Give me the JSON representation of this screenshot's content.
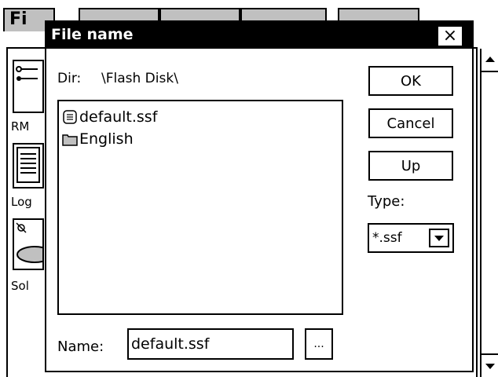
{
  "background": {
    "tab_file_label": "Fi",
    "items": [
      {
        "label": "RM",
        "icon": "connector-icon"
      },
      {
        "label": "Log",
        "icon": "log-document-icon"
      },
      {
        "label": "Sol",
        "icon": "satellite-dish-icon"
      }
    ]
  },
  "dialog": {
    "title": "File name",
    "close_label": "×",
    "dir_prefix": "Dir:",
    "dir_value": "\\Flash Disk\\",
    "files": [
      {
        "name": "default.ssf",
        "icon": "document-icon"
      },
      {
        "name": "English",
        "icon": "folder-icon"
      }
    ],
    "buttons": {
      "ok": "OK",
      "cancel": "Cancel",
      "up": "Up"
    },
    "type_label": "Type:",
    "type_value": "*.ssf",
    "name_label": "Name:",
    "name_value": "default.ssf",
    "browse_label": "..."
  }
}
